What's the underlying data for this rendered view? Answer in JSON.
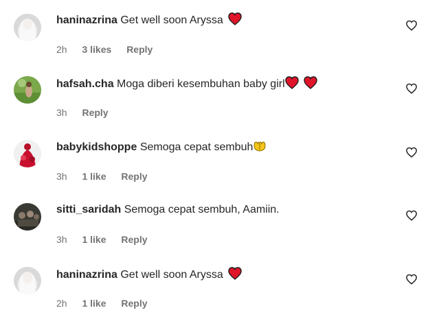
{
  "comments": [
    {
      "username": "haninazrina",
      "text": "Get well soon Aryssa",
      "emoji": [
        "red-heart"
      ],
      "time": "2h",
      "likes": "3 likes",
      "reply": "Reply",
      "avatar": "white-veil-portrait"
    },
    {
      "username": "hafsah.cha",
      "text": "Moga diberi kesembuhan baby girl",
      "emoji": [
        "red-heart",
        "red-heart"
      ],
      "time": "3h",
      "likes": "",
      "reply": "Reply",
      "avatar": "child-in-green-field"
    },
    {
      "username": "babykidshoppe",
      "text": "Semoga cepat sembuh",
      "emoji": [
        "open-hands"
      ],
      "time": "3h",
      "likes": "1 like",
      "reply": "Reply",
      "avatar": "red-dress"
    },
    {
      "username": "sitti_saridah",
      "text": "Semoga cepat sembuh, Aamiin.",
      "emoji": [],
      "time": "3h",
      "likes": "1 like",
      "reply": "Reply",
      "avatar": "group-photo"
    },
    {
      "username": "haninazrina",
      "text": "Get well soon Aryssa",
      "emoji": [
        "red-heart"
      ],
      "time": "2h",
      "likes": "1 like",
      "reply": "Reply",
      "avatar": "white-veil-portrait"
    }
  ],
  "colors": {
    "text": "#262626",
    "secondary": "#737373",
    "heart": "#e0152a"
  }
}
